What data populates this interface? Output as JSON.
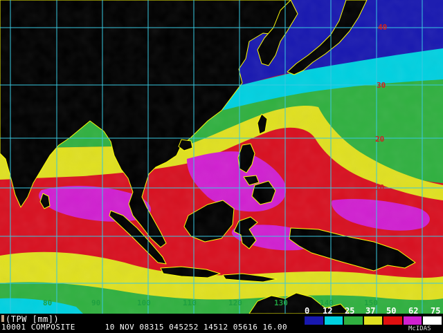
{
  "product": {
    "units_label": "(TPW [mm])",
    "line2": "10001 COMPOSITE      10 NOV 08315 045252 14512 05616 16.00",
    "credit": "McIDAS"
  },
  "lat_labels": [
    "40",
    "30",
    "20",
    "10"
  ],
  "lon_labels": [
    "80",
    "90",
    "100",
    "110",
    "120",
    "130",
    "140",
    "150"
  ],
  "legend": {
    "ticks": [
      "0",
      "12",
      "25",
      "37",
      "50",
      "62",
      "75"
    ],
    "colors": [
      "#1818b0",
      "#00d0e0",
      "#30b040",
      "#e0e020",
      "#e01010",
      "#d020d0",
      "#ffffff"
    ]
  },
  "colors": {
    "grid": "#38c8e0",
    "coast": "#ffff00",
    "land": "#000000",
    "lat_label": "#d02020",
    "lon_label": "#1fa040"
  }
}
